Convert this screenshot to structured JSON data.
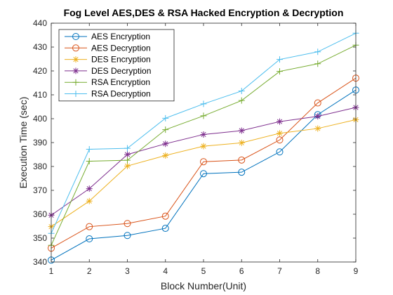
{
  "chart_data": {
    "type": "line",
    "title": "Fog Level AES,DES & RSA Hacked Encryption & Decryption",
    "xlabel": "Block Number(Unit)",
    "ylabel": "Execution Time (sec)",
    "xlim": [
      1,
      9
    ],
    "ylim": [
      340,
      440
    ],
    "xticks": [
      1,
      2,
      3,
      4,
      5,
      6,
      7,
      8,
      9
    ],
    "yticks": [
      340,
      350,
      360,
      370,
      380,
      390,
      400,
      410,
      420,
      430,
      440
    ],
    "legend_position": "top-left",
    "x": [
      1,
      2,
      3,
      4,
      5,
      6,
      7,
      8,
      9
    ],
    "series": [
      {
        "name": "AES Encryption",
        "color": "#0072BD",
        "marker": "circle",
        "values": [
          340.8,
          349.7,
          351.1,
          354.1,
          377.0,
          377.6,
          386.1,
          401.7,
          412.0
        ]
      },
      {
        "name": "AES Decryption",
        "color": "#D95319",
        "marker": "circle",
        "values": [
          345.8,
          354.8,
          356.1,
          359.2,
          382.0,
          382.7,
          391.1,
          406.6,
          417.0
        ]
      },
      {
        "name": "DES Encryption",
        "color": "#EDB120",
        "marker": "star",
        "values": [
          354.8,
          365.5,
          380.2,
          384.6,
          388.5,
          389.9,
          393.9,
          395.9,
          399.6
        ]
      },
      {
        "name": "DES Decryption",
        "color": "#7E2F8E",
        "marker": "star",
        "values": [
          359.6,
          370.7,
          385.0,
          389.5,
          393.4,
          395.0,
          398.8,
          401.0,
          404.7
        ]
      },
      {
        "name": "RSA Encryption",
        "color": "#77AC30",
        "marker": "plus",
        "values": [
          347.0,
          382.2,
          382.6,
          395.4,
          401.2,
          407.6,
          419.8,
          423.0,
          430.8
        ]
      },
      {
        "name": "RSA Decryption",
        "color": "#4DBEEE",
        "marker": "plus",
        "values": [
          352.0,
          387.2,
          387.6,
          400.2,
          406.2,
          411.6,
          424.8,
          428.0,
          435.8
        ]
      }
    ]
  }
}
